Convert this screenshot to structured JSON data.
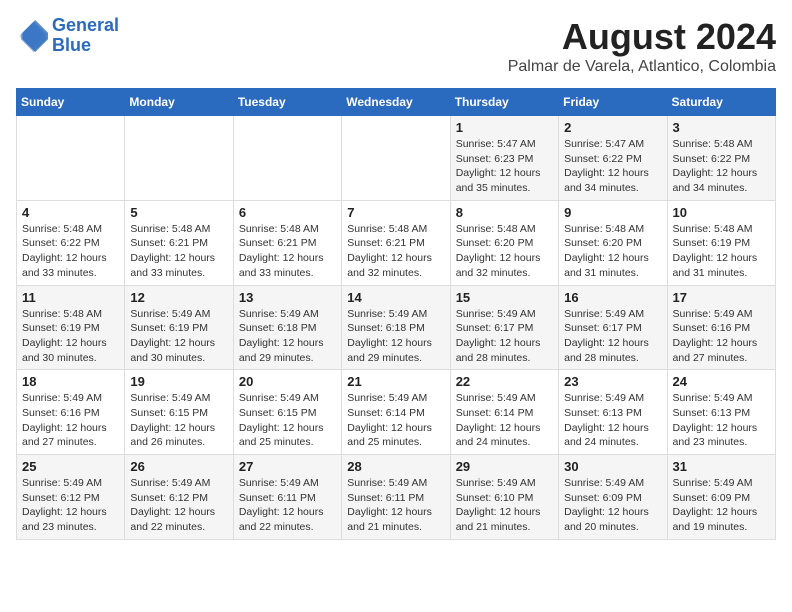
{
  "header": {
    "logo_line1": "General",
    "logo_line2": "Blue",
    "title": "August 2024",
    "subtitle": "Palmar de Varela, Atlantico, Colombia"
  },
  "weekdays": [
    "Sunday",
    "Monday",
    "Tuesday",
    "Wednesday",
    "Thursday",
    "Friday",
    "Saturday"
  ],
  "weeks": [
    [
      {
        "day": "",
        "info": ""
      },
      {
        "day": "",
        "info": ""
      },
      {
        "day": "",
        "info": ""
      },
      {
        "day": "",
        "info": ""
      },
      {
        "day": "1",
        "info": "Sunrise: 5:47 AM\nSunset: 6:23 PM\nDaylight: 12 hours\nand 35 minutes."
      },
      {
        "day": "2",
        "info": "Sunrise: 5:47 AM\nSunset: 6:22 PM\nDaylight: 12 hours\nand 34 minutes."
      },
      {
        "day": "3",
        "info": "Sunrise: 5:48 AM\nSunset: 6:22 PM\nDaylight: 12 hours\nand 34 minutes."
      }
    ],
    [
      {
        "day": "4",
        "info": "Sunrise: 5:48 AM\nSunset: 6:22 PM\nDaylight: 12 hours\nand 33 minutes."
      },
      {
        "day": "5",
        "info": "Sunrise: 5:48 AM\nSunset: 6:21 PM\nDaylight: 12 hours\nand 33 minutes."
      },
      {
        "day": "6",
        "info": "Sunrise: 5:48 AM\nSunset: 6:21 PM\nDaylight: 12 hours\nand 33 minutes."
      },
      {
        "day": "7",
        "info": "Sunrise: 5:48 AM\nSunset: 6:21 PM\nDaylight: 12 hours\nand 32 minutes."
      },
      {
        "day": "8",
        "info": "Sunrise: 5:48 AM\nSunset: 6:20 PM\nDaylight: 12 hours\nand 32 minutes."
      },
      {
        "day": "9",
        "info": "Sunrise: 5:48 AM\nSunset: 6:20 PM\nDaylight: 12 hours\nand 31 minutes."
      },
      {
        "day": "10",
        "info": "Sunrise: 5:48 AM\nSunset: 6:19 PM\nDaylight: 12 hours\nand 31 minutes."
      }
    ],
    [
      {
        "day": "11",
        "info": "Sunrise: 5:48 AM\nSunset: 6:19 PM\nDaylight: 12 hours\nand 30 minutes."
      },
      {
        "day": "12",
        "info": "Sunrise: 5:49 AM\nSunset: 6:19 PM\nDaylight: 12 hours\nand 30 minutes."
      },
      {
        "day": "13",
        "info": "Sunrise: 5:49 AM\nSunset: 6:18 PM\nDaylight: 12 hours\nand 29 minutes."
      },
      {
        "day": "14",
        "info": "Sunrise: 5:49 AM\nSunset: 6:18 PM\nDaylight: 12 hours\nand 29 minutes."
      },
      {
        "day": "15",
        "info": "Sunrise: 5:49 AM\nSunset: 6:17 PM\nDaylight: 12 hours\nand 28 minutes."
      },
      {
        "day": "16",
        "info": "Sunrise: 5:49 AM\nSunset: 6:17 PM\nDaylight: 12 hours\nand 28 minutes."
      },
      {
        "day": "17",
        "info": "Sunrise: 5:49 AM\nSunset: 6:16 PM\nDaylight: 12 hours\nand 27 minutes."
      }
    ],
    [
      {
        "day": "18",
        "info": "Sunrise: 5:49 AM\nSunset: 6:16 PM\nDaylight: 12 hours\nand 27 minutes."
      },
      {
        "day": "19",
        "info": "Sunrise: 5:49 AM\nSunset: 6:15 PM\nDaylight: 12 hours\nand 26 minutes."
      },
      {
        "day": "20",
        "info": "Sunrise: 5:49 AM\nSunset: 6:15 PM\nDaylight: 12 hours\nand 25 minutes."
      },
      {
        "day": "21",
        "info": "Sunrise: 5:49 AM\nSunset: 6:14 PM\nDaylight: 12 hours\nand 25 minutes."
      },
      {
        "day": "22",
        "info": "Sunrise: 5:49 AM\nSunset: 6:14 PM\nDaylight: 12 hours\nand 24 minutes."
      },
      {
        "day": "23",
        "info": "Sunrise: 5:49 AM\nSunset: 6:13 PM\nDaylight: 12 hours\nand 24 minutes."
      },
      {
        "day": "24",
        "info": "Sunrise: 5:49 AM\nSunset: 6:13 PM\nDaylight: 12 hours\nand 23 minutes."
      }
    ],
    [
      {
        "day": "25",
        "info": "Sunrise: 5:49 AM\nSunset: 6:12 PM\nDaylight: 12 hours\nand 23 minutes."
      },
      {
        "day": "26",
        "info": "Sunrise: 5:49 AM\nSunset: 6:12 PM\nDaylight: 12 hours\nand 22 minutes."
      },
      {
        "day": "27",
        "info": "Sunrise: 5:49 AM\nSunset: 6:11 PM\nDaylight: 12 hours\nand 22 minutes."
      },
      {
        "day": "28",
        "info": "Sunrise: 5:49 AM\nSunset: 6:11 PM\nDaylight: 12 hours\nand 21 minutes."
      },
      {
        "day": "29",
        "info": "Sunrise: 5:49 AM\nSunset: 6:10 PM\nDaylight: 12 hours\nand 21 minutes."
      },
      {
        "day": "30",
        "info": "Sunrise: 5:49 AM\nSunset: 6:09 PM\nDaylight: 12 hours\nand 20 minutes."
      },
      {
        "day": "31",
        "info": "Sunrise: 5:49 AM\nSunset: 6:09 PM\nDaylight: 12 hours\nand 19 minutes."
      }
    ]
  ]
}
